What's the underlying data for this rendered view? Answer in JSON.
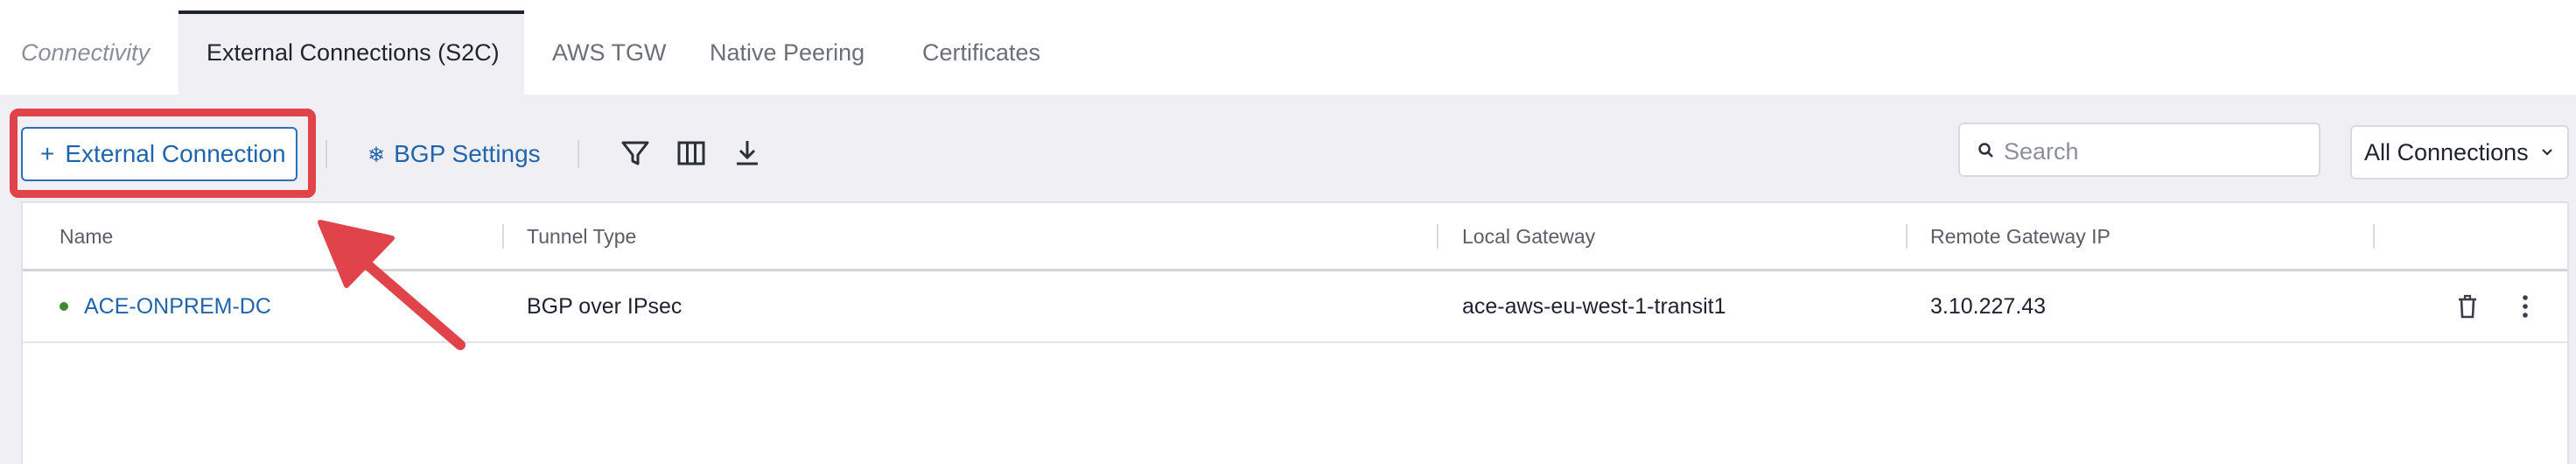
{
  "tabs": [
    {
      "label": "Connectivity"
    },
    {
      "label": "External Connections (S2C)"
    },
    {
      "label": "AWS TGW"
    },
    {
      "label": "Native Peering"
    },
    {
      "label": "Certificates"
    }
  ],
  "toolbar": {
    "add_label": "External Connection",
    "add_prefix": "+",
    "bgp_label": "BGP Settings",
    "icons": [
      "filter-icon",
      "columns-icon",
      "download-icon"
    ]
  },
  "search": {
    "placeholder": "Search",
    "value": ""
  },
  "filter_dropdown": {
    "selected": "All Connections"
  },
  "table": {
    "columns": [
      "Name",
      "Tunnel Type",
      "Local Gateway",
      "Remote Gateway IP"
    ],
    "rows": [
      {
        "status": "up",
        "name": "ACE-ONPREM-DC",
        "tunnel_type": "BGP over IPsec",
        "local_gateway": "ace-aws-eu-west-1-transit1",
        "remote_gateway_ip": "3.10.227.43"
      }
    ]
  },
  "colors": {
    "accent": "#1f64ad",
    "highlight": "#e0434a",
    "status_up": "#3a8d2e"
  }
}
